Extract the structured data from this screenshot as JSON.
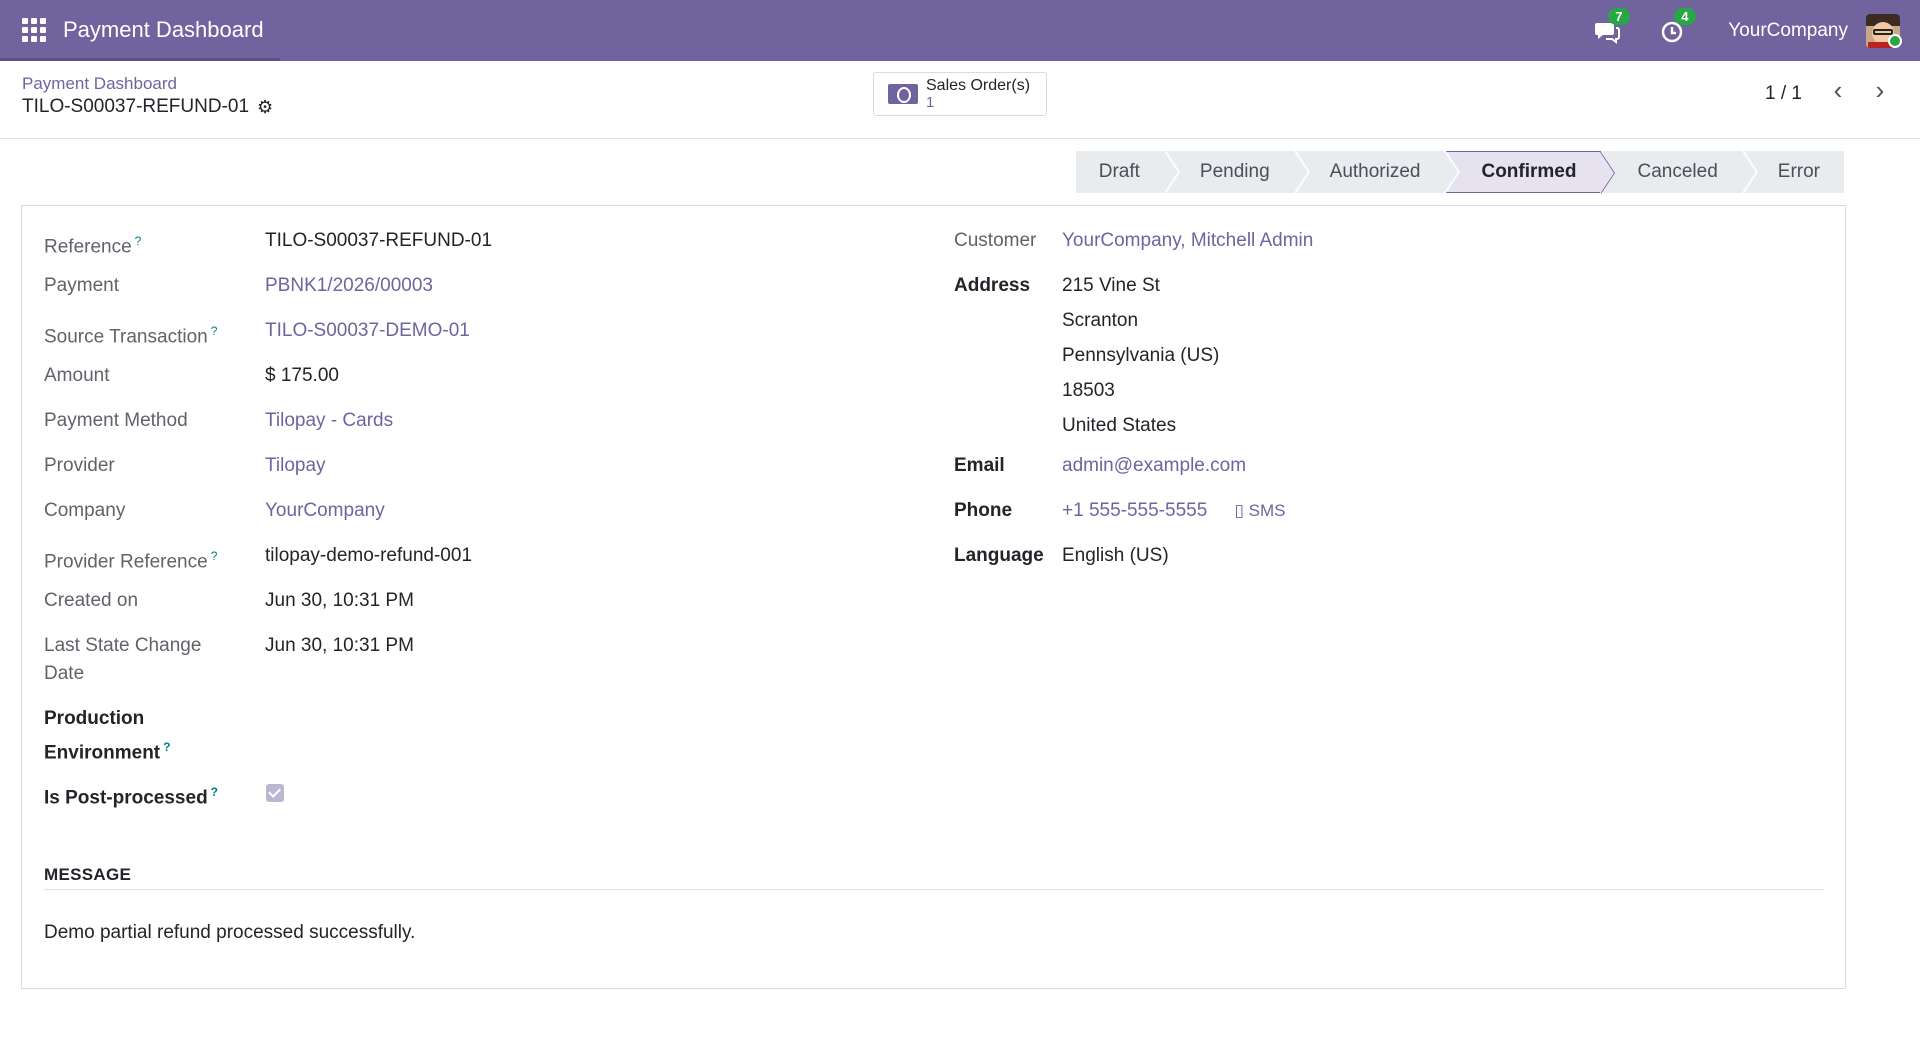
{
  "navbar": {
    "app_title": "Payment Dashboard",
    "messages_count": "7",
    "activities_count": "4",
    "company": "YourCompany"
  },
  "control": {
    "breadcrumb": "Payment Dashboard",
    "record_title": "TILO-S00037-REFUND-01",
    "smart_button_label": "Sales Order(s)",
    "smart_button_value": "1",
    "pager": "1 / 1"
  },
  "statusbar": {
    "stages": [
      "Draft",
      "Pending",
      "Authorized",
      "Confirmed",
      "Canceled",
      "Error"
    ],
    "active": "Confirmed"
  },
  "left_fields": {
    "reference_label": "Reference",
    "reference_value": "TILO-S00037-REFUND-01",
    "payment_label": "Payment",
    "payment_value": "PBNK1/2026/00003",
    "source_label": "Source Transaction",
    "source_value": "TILO-S00037-DEMO-01",
    "amount_label": "Amount",
    "amount_value": "$ 175.00",
    "method_label": "Payment Method",
    "method_value": "Tilopay - Cards",
    "provider_label": "Provider",
    "provider_value": "Tilopay",
    "company_label": "Company",
    "company_value": "YourCompany",
    "provider_ref_label": "Provider Reference",
    "provider_ref_value": "tilopay-demo-refund-001",
    "created_label": "Created on",
    "created_value": "Jun 30, 10:31 PM",
    "last_state_label_1": "Last State Change",
    "last_state_label_2": "Date",
    "last_state_value": "Jun 30, 10:31 PM",
    "prod_env_label_1": "Production",
    "prod_env_label_2": "Environment",
    "post_processed_label": "Is Post-processed",
    "post_processed_checked": true
  },
  "right_fields": {
    "customer_label": "Customer",
    "customer_value": "YourCompany, Mitchell Admin",
    "address_label": "Address",
    "address_lines": [
      "215 Vine St",
      "Scranton",
      "Pennsylvania (US)",
      "18503",
      "United States"
    ],
    "email_label": "Email",
    "email_value": "admin@example.com",
    "phone_label": "Phone",
    "phone_value": "+1 555-555-5555",
    "sms_label": "SMS",
    "language_label": "Language",
    "language_value": "English (US)"
  },
  "message_section": {
    "title": "MESSAGE",
    "text": "Demo partial refund processed successfully."
  },
  "help_marker": "?",
  "colors": {
    "navbar": "#71639e",
    "link": "#71639e",
    "badge": "#28a745"
  }
}
